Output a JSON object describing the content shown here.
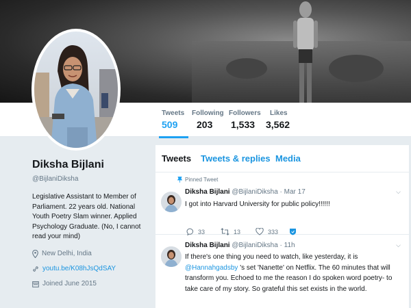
{
  "profile": {
    "name": "Diksha Bijlani",
    "handle": "@BijlaniDiksha",
    "bio": "Legislative Assistant to Member of Parliament. 22 years old. National Youth Poetry Slam winner. Applied Psychology Graduate. (No, I cannot read your mind)",
    "location": "New Delhi, India",
    "website": "youtu.be/K08hJsQdSAY",
    "joined": "Joined June 2015"
  },
  "stats": [
    {
      "label": "Tweets",
      "value": "509"
    },
    {
      "label": "Following",
      "value": "203"
    },
    {
      "label": "Followers",
      "value": "1,533"
    },
    {
      "label": "Likes",
      "value": "3,562"
    }
  ],
  "tabs": [
    {
      "label": "Tweets"
    },
    {
      "label": "Tweets & replies"
    },
    {
      "label": "Media"
    }
  ],
  "tweets": [
    {
      "pinned_label": "Pinned Tweet",
      "name": "Diksha Bijlani",
      "handle_date": "@BijlaniDiksha · Mar 17",
      "text": "I got into Harvard University for public policy!!!!!!",
      "replies": "33",
      "retweets": "13",
      "likes": "333"
    },
    {
      "name": "Diksha Bijlani",
      "handle_date": "@BijlaniDiksha · 11h",
      "text_before": "If there's one thing you need to watch, like yesterday, it is ",
      "mention": "@Hannahgadsby",
      "text_after": " 's set 'Nanette' on Netflix. The 60 minutes that will transform you. Echoed to me the reason I do spoken word poetry- to take care of my story. So grateful this set exists in the world."
    }
  ],
  "colors": {
    "accent": "#1da1f2",
    "link": "#1b95e0",
    "background": "#e6ecf0",
    "muted": "#657786"
  }
}
